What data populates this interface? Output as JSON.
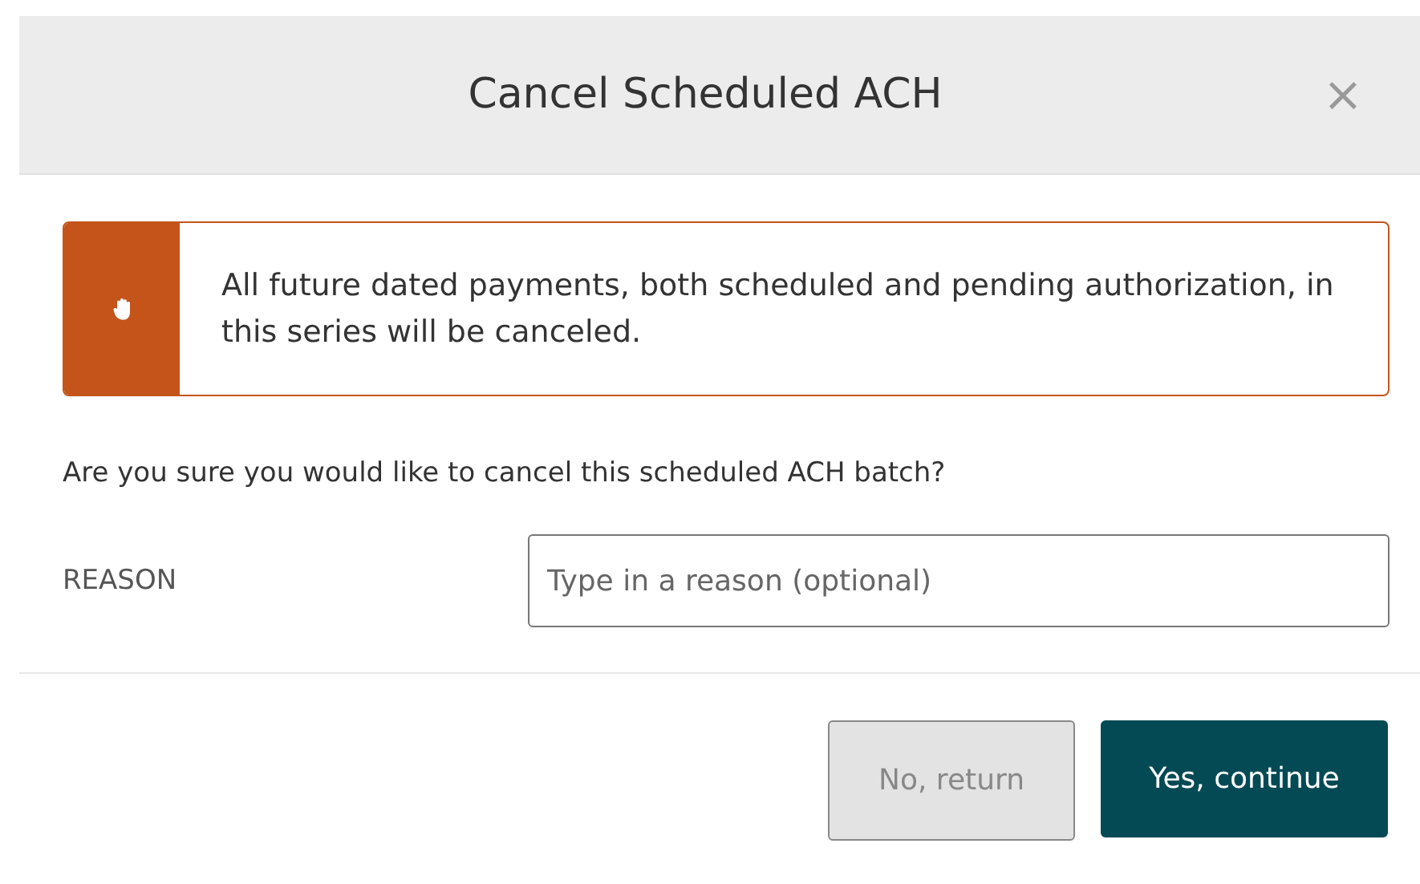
{
  "dialog": {
    "title": "Cancel Scheduled ACH",
    "close": "×"
  },
  "alert": {
    "text": "All future dated payments, both scheduled and pending authorization, in this series will be canceled."
  },
  "question": "Are you sure you would like to cancel this scheduled ACH batch?",
  "reason": {
    "label": "REASON",
    "placeholder": "Type in a reason (optional)"
  },
  "buttons": [
    {
      "label": "No, return",
      "kind": "secondary"
    },
    {
      "label": "Yes, continue",
      "kind": "primary"
    }
  ]
}
